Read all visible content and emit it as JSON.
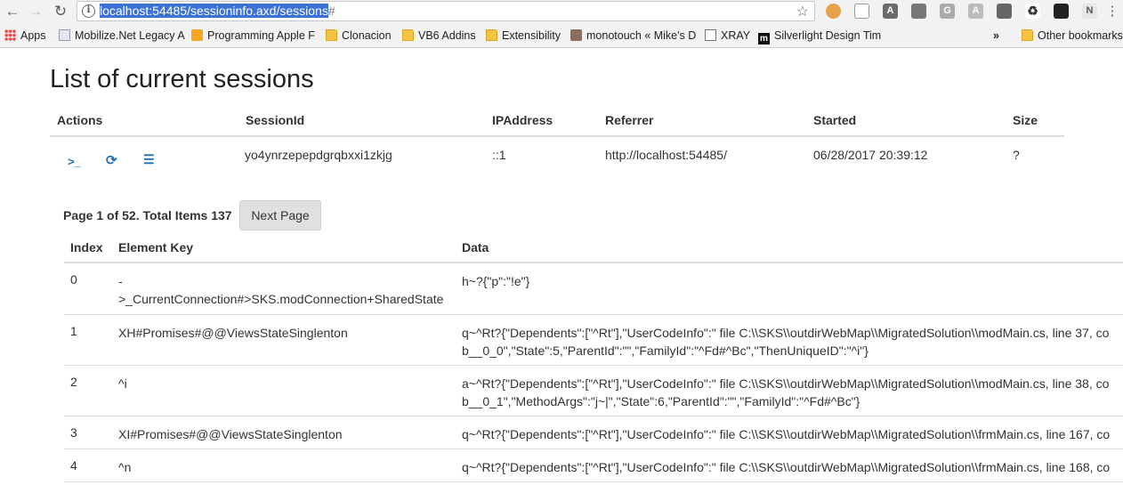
{
  "browser": {
    "url_selected": "localhost:54485/sessioninfo.axd/sessions",
    "url_hash": "#",
    "bookmarks": [
      {
        "label": "Apps",
        "icon": "apps-grid-icon"
      },
      {
        "label": "Mobilize.Net Legacy A",
        "icon": "page-icon"
      },
      {
        "label": "Programming Apple F",
        "icon": "bookmark-logo-icon"
      },
      {
        "label": "Clonacion",
        "icon": "folder-icon"
      },
      {
        "label": "VB6 Addins",
        "icon": "folder-icon"
      },
      {
        "label": "Extensibility",
        "icon": "folder-icon"
      },
      {
        "label": "monotouch « Mike's D",
        "icon": "avatar-icon"
      },
      {
        "label": "XRAY",
        "icon": "page-icon"
      },
      {
        "label": "Silverlight Design Tim",
        "icon": "m-logo-icon"
      },
      {
        "label": "»",
        "icon": "overflow-icon"
      },
      {
        "label": "Other bookmarks",
        "icon": "folder-icon"
      }
    ]
  },
  "page": {
    "title": "List of current sessions",
    "sessions_table": {
      "headers": [
        "Actions",
        "SessionId",
        "IPAddress",
        "Referrer",
        "Started",
        "Size"
      ],
      "row": {
        "action_icons": [
          "terminal-icon",
          "refresh-icon",
          "list-icon"
        ],
        "action_glyphs": [
          ">_",
          "⟳",
          "☰"
        ],
        "session_id": "yo4ynrzepepdgrqbxxi1zkjg",
        "ip": "::1",
        "referrer": "http://localhost:54485/",
        "started": "06/28/2017 20:39:12",
        "size": "?"
      }
    },
    "pager": {
      "text": "Page 1 of 52. Total Items 137",
      "next_label": "Next Page"
    },
    "items_table": {
      "headers": [
        "Index",
        "Element Key",
        "Data"
      ],
      "rows": [
        {
          "index": "0",
          "key": "->_CurrentConnection#>SKS.modConnection+SharedState",
          "key_l1": "-",
          "key_l2": ">_CurrentConnection#>SKS.modConnection+SharedState",
          "data_l1": "h~?{\"p\":\"!e\"}",
          "data_l2": ""
        },
        {
          "index": "1",
          "key_l1": "XH#Promises#@@ViewsStateSinglenton",
          "key_l2": "",
          "data_l1": "q~^Rt?{\"Dependents\":[\"^Rt\"],\"UserCodeInfo\":\" file C:\\\\SKS\\\\outdirWebMap\\\\MigratedSolution\\\\modMain.cs, line 37, co",
          "data_l2": "b__0_0\",\"State\":5,\"ParentId\":\"\",\"FamilyId\":\"^Fd#^Bc\",\"ThenUniqueID\":\"^i\"}"
        },
        {
          "index": "2",
          "key_l1": "^i",
          "key_l2": "",
          "data_l1": "a~^Rt?{\"Dependents\":[\"^Rt\"],\"UserCodeInfo\":\" file C:\\\\SKS\\\\outdirWebMap\\\\MigratedSolution\\\\modMain.cs, line 38, co",
          "data_l2": "b__0_1\",\"MethodArgs\":\"j~|\",\"State\":6,\"ParentId\":\"\",\"FamilyId\":\"^Fd#^Bc\"}"
        },
        {
          "index": "3",
          "key_l1": "XI#Promises#@@ViewsStateSinglenton",
          "key_l2": "",
          "data_l1": "q~^Rt?{\"Dependents\":[\"^Rt\"],\"UserCodeInfo\":\" file C:\\\\SKS\\\\outdirWebMap\\\\MigratedSolution\\\\frmMain.cs, line 167, co",
          "data_l2": ""
        },
        {
          "index": "4",
          "key_l1": "^n",
          "key_l2": "",
          "data_l1": "q~^Rt?{\"Dependents\":[\"^Rt\"],\"UserCodeInfo\":\" file C:\\\\SKS\\\\outdirWebMap\\\\MigratedSolution\\\\frmMain.cs, line 168, co",
          "data_l2": ""
        }
      ]
    }
  }
}
